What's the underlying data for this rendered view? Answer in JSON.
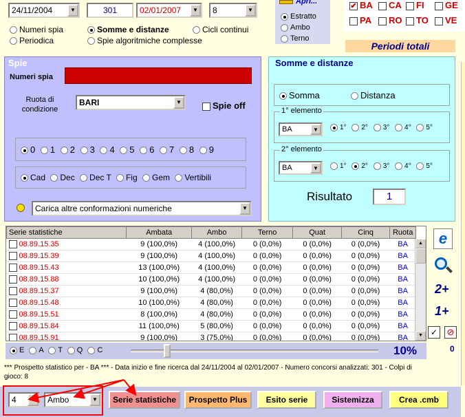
{
  "top": {
    "date_start": "24/11/2004",
    "concorsi": "301",
    "date_end": "02/01/2007",
    "num_select": "8",
    "modes": [
      "Numeri spia",
      "Somme e distanze",
      "Cicli continui",
      "Periodica",
      "Spie algoritmiche complesse"
    ],
    "apri_label": "Apri...",
    "source_opts": [
      "Estratto",
      "Ambo",
      "Terno"
    ]
  },
  "ruote_top": {
    "row1": [
      "BA",
      "CA",
      "FI",
      "GE"
    ],
    "row2": [
      "PA",
      "RO",
      "TO",
      "VE"
    ]
  },
  "periodi_label": "Periodi totali",
  "spie": {
    "title": "Spie",
    "numeri_spia_label": "Numeri spia",
    "ruota_label": "Ruota di condizione",
    "ruota_value": "BARI",
    "spie_off": "Spie off",
    "numbers": [
      "0",
      "1",
      "2",
      "3",
      "4",
      "5",
      "6",
      "7",
      "8",
      "9"
    ],
    "groups": [
      "Cad",
      "Dec",
      "Dec T",
      "Fig",
      "Gem",
      "Vertibili"
    ],
    "conformazioni": "Carica altre conformazioni numeriche"
  },
  "somme": {
    "title": "Somme e distanze",
    "op_somma": "Somma",
    "op_distanza": "Distanza",
    "el1_title": "1° elemento",
    "el1_value": "BA",
    "el2_title": "2° elemento",
    "el2_value": "BA",
    "positions": [
      "1°",
      "2°",
      "3°",
      "4°",
      "5°"
    ],
    "risultato_label": "Risultato",
    "risultato_value": "1"
  },
  "table": {
    "headers": [
      "Serie statistiche",
      "Ambata",
      "Ambo",
      "Terno",
      "Quat",
      "Cinq",
      "Ruota"
    ],
    "rows": [
      {
        "serie": "08.89.15.35",
        "ambata": "9 (100,0%)",
        "ambo": "4 (100,0%)",
        "terno": "0 (0,0%)",
        "quat": "0 (0,0%)",
        "cinq": "0 (0,0%)",
        "ruota": "BA"
      },
      {
        "serie": "08.89.15.39",
        "ambata": "9 (100,0%)",
        "ambo": "4 (100,0%)",
        "terno": "0 (0,0%)",
        "quat": "0 (0,0%)",
        "cinq": "0 (0,0%)",
        "ruota": "BA"
      },
      {
        "serie": "08.89.15.43",
        "ambata": "13 (100,0%)",
        "ambo": "4 (100,0%)",
        "terno": "0 (0,0%)",
        "quat": "0 (0,0%)",
        "cinq": "0 (0,0%)",
        "ruota": "BA"
      },
      {
        "serie": "08.89.15.88",
        "ambata": "10 (100,0%)",
        "ambo": "4 (100,0%)",
        "terno": "0 (0,0%)",
        "quat": "0 (0,0%)",
        "cinq": "0 (0,0%)",
        "ruota": "BA"
      },
      {
        "serie": "08.89.15.37",
        "ambata": "9 (100,0%)",
        "ambo": "4 (80,0%)",
        "terno": "0 (0,0%)",
        "quat": "0 (0,0%)",
        "cinq": "0 (0,0%)",
        "ruota": "BA"
      },
      {
        "serie": "08.89.15.48",
        "ambata": "10 (100,0%)",
        "ambo": "4 (80,0%)",
        "terno": "0 (0,0%)",
        "quat": "0 (0,0%)",
        "cinq": "0 (0,0%)",
        "ruota": "BA"
      },
      {
        "serie": "08.89.15.51",
        "ambata": "8 (100,0%)",
        "ambo": "4 (80,0%)",
        "terno": "0 (0,0%)",
        "quat": "0 (0,0%)",
        "cinq": "0 (0,0%)",
        "ruota": "BA"
      },
      {
        "serie": "08.89.15.84",
        "ambata": "11 (100,0%)",
        "ambo": "5 (80,0%)",
        "terno": "0 (0,0%)",
        "quat": "0 (0,0%)",
        "cinq": "0 (0,0%)",
        "ruota": "BA"
      },
      {
        "serie": "08.89.15.91",
        "ambata": "9 (100,0%)",
        "ambo": "3 (75,0%)",
        "terno": "0 (0,0%)",
        "quat": "0 (0,0%)",
        "cinq": "0 (0,0%)",
        "ruota": "BA"
      }
    ]
  },
  "filter_opts": [
    "E",
    "A",
    "T",
    "Q",
    "C"
  ],
  "percent": "10%",
  "side_labels": {
    "two_plus": "2+",
    "one_plus": "1+",
    "count": "0"
  },
  "prospetto_text": "*** Prospetto statistico per   - BA *** - Data inizio e fine ricerca dal 24/11/2004 al 02/01/2007 - Numero concorsi analizzati: 301 - Colpi di gioco: 8",
  "bottom": {
    "num_value": "4",
    "sorte_value": "Ambo",
    "buttons": [
      "Serie statistiche",
      "Prospetto Plus",
      "Esito serie",
      "Sistemizza",
      "Crea .cmb"
    ]
  },
  "colors": {
    "accent_red": "#ff0000",
    "spie_bg": "#c0c0ff",
    "somme_bg": "#c0ffff",
    "serie_red": "#cc0000",
    "blue_text": "#0000cc"
  }
}
